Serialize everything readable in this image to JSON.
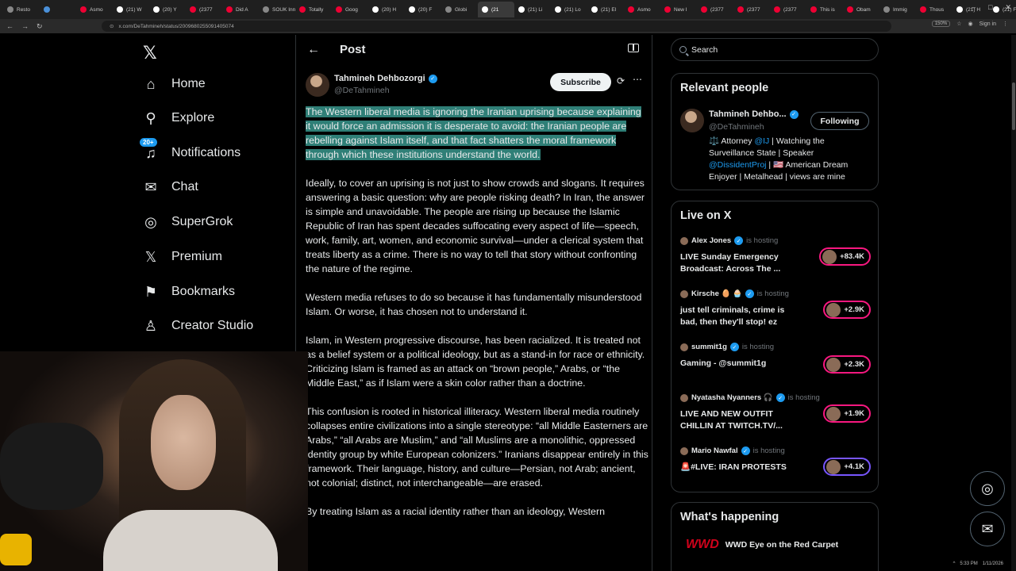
{
  "browser": {
    "tabs": [
      {
        "label": "Resto",
        "color": "#888"
      },
      {
        "label": "",
        "color": "#4a90d9"
      },
      {
        "label": "Asmo",
        "color": "#e03"
      },
      {
        "label": "(21) W",
        "color": "#fff"
      },
      {
        "label": "(20) Y",
        "color": "#fff"
      },
      {
        "label": "(2377",
        "color": "#e03"
      },
      {
        "label": "Did A",
        "color": "#e03"
      },
      {
        "label": "SOUK Inn",
        "color": "#888"
      },
      {
        "label": "Totally",
        "color": "#e03"
      },
      {
        "label": "Goog",
        "color": "#e03"
      },
      {
        "label": "(20) H",
        "color": "#fff"
      },
      {
        "label": "(20) F",
        "color": "#fff"
      },
      {
        "label": "Globi",
        "color": "#888"
      },
      {
        "label": "(21",
        "color": "#fff",
        "active": true
      },
      {
        "label": "(21) Li",
        "color": "#fff"
      },
      {
        "label": "(21) Lo",
        "color": "#fff"
      },
      {
        "label": "(21) El",
        "color": "#fff"
      },
      {
        "label": "Asmo",
        "color": "#e03"
      },
      {
        "label": "New I",
        "color": "#e03"
      },
      {
        "label": "(2377",
        "color": "#e03"
      },
      {
        "label": "(2377",
        "color": "#e03"
      },
      {
        "label": "(2377",
        "color": "#e03"
      },
      {
        "label": "This is",
        "color": "#e03"
      },
      {
        "label": "Obam",
        "color": "#e03"
      },
      {
        "label": "Immig",
        "color": "#888"
      },
      {
        "label": "Thous",
        "color": "#e03"
      },
      {
        "label": "(21) H",
        "color": "#fff"
      },
      {
        "label": "(21) F",
        "color": "#fff"
      },
      {
        "label": "(2",
        "color": "#fff"
      }
    ],
    "new_tab": "+",
    "url": "x.com/DeTahmineh/status/2009680255091405074",
    "zoom": "150%",
    "sign_in": "Sign in",
    "window_controls": [
      "–",
      "□",
      "✕"
    ]
  },
  "nav": {
    "logo": "𝕏",
    "items": [
      {
        "label": "Home",
        "icon": "home-icon",
        "glyph": "⌂"
      },
      {
        "label": "Explore",
        "icon": "search-icon",
        "glyph": "⚲"
      },
      {
        "label": "Notifications",
        "icon": "bell-icon",
        "glyph": "♫",
        "badge": "20+"
      },
      {
        "label": "Chat",
        "icon": "mail-icon",
        "glyph": "✉"
      },
      {
        "label": "SuperGrok",
        "icon": "grok-icon",
        "glyph": "◎"
      },
      {
        "label": "Premium",
        "icon": "x-premium-icon",
        "glyph": "𝕏"
      },
      {
        "label": "Bookmarks",
        "icon": "bookmark-icon",
        "glyph": "⚑"
      },
      {
        "label": "Creator Studio",
        "icon": "creator-studio-icon",
        "glyph": "♙"
      }
    ]
  },
  "post": {
    "header_title": "Post",
    "author_name": "Tahmineh Dehbozorgi",
    "author_handle": "@DeTahmineh",
    "subscribe_label": "Subscribe",
    "highlighted_text": "The Western liberal media is ignoring the Iranian uprising because explaining it would force an admission it is desperate to avoid: the Iranian people are rebelling against Islam itself, and that fact shatters the moral framework through which these institutions understand the world.",
    "paragraphs": [
      "Ideally, to cover an uprising is not just to show crowds and slogans. It requires answering a basic question: why are people risking death? In Iran, the answer is simple and unavoidable. The people are rising up because the Islamic Republic of Iran has spent decades suffocating every aspect of life—speech, work, family, art, women, and economic survival—under a clerical system that treats liberty as a crime. There is no way to tell that story without confronting the nature of the regime.",
      "Western media refuses to do so because it has fundamentally misunderstood Islam. Or worse, it has chosen not to understand it.",
      "Islam, in Western progressive discourse, has been racialized. It is treated not as a belief system or a political ideology, but as a stand-in for race or ethnicity. Criticizing Islam is framed as an attack on “brown people,” Arabs, or “the Middle East,” as if Islam were a skin color rather than a doctrine.",
      "This confusion is rooted in historical illiteracy. Western liberal media routinely collapses entire civilizations into a single stereotype: “all Middle Easterners are Arabs,” “all Arabs are Muslim,” and “all Muslims are a monolithic, oppressed identity group by white European colonizers.” Iranians disappear entirely in this framework. Their language, history, and culture—Persian, not Arab; ancient, not colonial; distinct, not interchangeable—are erased.",
      "By treating Islam as a racial identity rather than an ideology, Western"
    ]
  },
  "right": {
    "search_placeholder": "Search",
    "relevant_title": "Relevant people",
    "relevant_person": {
      "name": "Tahmineh Dehbo...",
      "handle": "@DeTahmineh",
      "button": "Following",
      "bio_a": "⚖️ Attorney ",
      "bio_link1": "@IJ",
      "bio_b": " | Watching the Surveillance State | Speaker ",
      "bio_link2": "@DissidentProj",
      "bio_c": " | 🇺🇸 American Dream Enjoyer | Metalhead | views are mine"
    },
    "live_title": "Live on X",
    "live_items": [
      {
        "host": "Alex Jones",
        "is_hosting": "is hosting",
        "title": "LIVE Sunday Emergency Broadcast: Across The ...",
        "count": "+83.4K"
      },
      {
        "host": "Kirsche 🥚 🧁",
        "is_hosting": "is hosting",
        "title": "just tell criminals, crime is bad, then they'll stop! ez",
        "count": "+2.9K"
      },
      {
        "host": "summit1g",
        "is_hosting": "is hosting",
        "title": "Gaming - @summit1g",
        "count": "+2.3K"
      },
      {
        "host": "Nyatasha Nyanners 🎧",
        "is_hosting": "is hosting",
        "title": "LIVE AND NEW OUTFIT CHILLIN AT TWITCH.TV/...",
        "count": "+1.9K"
      },
      {
        "host": "Mario Nawfal",
        "is_hosting": "is hosting",
        "title": "🚨#LIVE: IRAN PROTESTS",
        "count": "+4.1K"
      }
    ],
    "happening_title": "What's happening",
    "happening_item_logo": "WWD",
    "happening_item_text": "WWD Eye on the Red Carpet"
  },
  "tray": {
    "time": "5:33 PM",
    "date": "1/11/2026"
  }
}
